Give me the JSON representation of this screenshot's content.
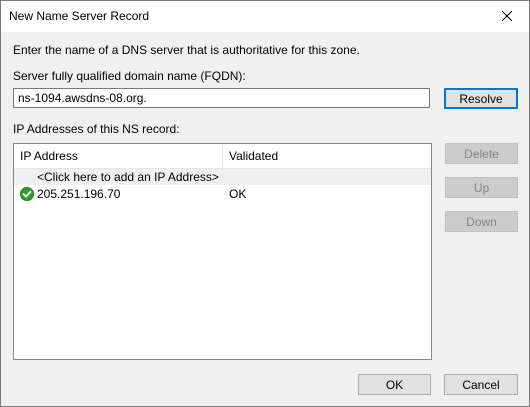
{
  "window": {
    "title": "New Name Server Record"
  },
  "intro_text": "Enter the name of a DNS server that is authoritative for this zone.",
  "fqdn": {
    "label": "Server fully qualified domain name (FQDN):",
    "value": "ns-1094.awsdns-08.org."
  },
  "resolve_label": "Resolve",
  "ip_section_label": "IP Addresses of this NS record:",
  "table": {
    "columns": [
      "IP Address",
      "Validated"
    ],
    "add_row_text": "<Click here to add an IP Address>",
    "rows": [
      {
        "status_icon": "check-circle-icon",
        "ip": "205.251.196.70",
        "validated": "OK"
      }
    ]
  },
  "side_buttons": {
    "delete_label": "Delete",
    "up_label": "Up",
    "down_label": "Down"
  },
  "footer": {
    "ok_label": "OK",
    "cancel_label": "Cancel"
  },
  "colors": {
    "accent": "#0078d7",
    "ok_green": "#2f9e2f"
  }
}
